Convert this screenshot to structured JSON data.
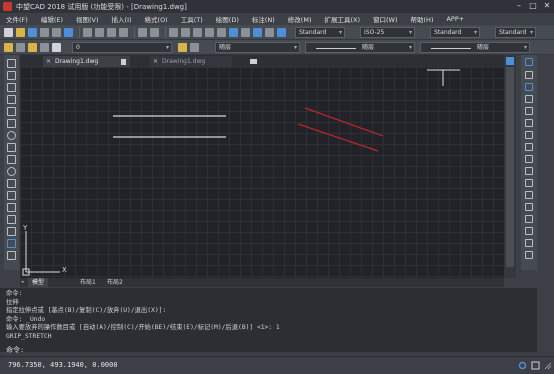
{
  "window": {
    "title": "中望CAD 2018 试用版 (功能受限) - [Drawing1.dwg]",
    "controls": [
      "–",
      "□",
      "✕"
    ]
  },
  "menu": [
    "文件(F)",
    "编辑(E)",
    "视图(V)",
    "插入(I)",
    "格式(O)",
    "工具(T)",
    "绘图(D)",
    "标注(N)",
    "修改(M)",
    "扩展工具(X)",
    "窗口(W)",
    "帮助(H)",
    "APP+"
  ],
  "toolbar": {
    "text_style": "Standard",
    "dim_style": "ISO-25",
    "table_style": "Standard",
    "multileader_style": "Standard",
    "layer": "0",
    "color": "随层",
    "linetype": "随层",
    "lineweight": "随层"
  },
  "doc_tabs": [
    {
      "label": "Drawing1.dwg",
      "active": true
    },
    {
      "label": "Drawing1.dwg",
      "active": false
    }
  ],
  "ucs": {
    "x": "X",
    "y": "Y"
  },
  "layout_tabs": [
    "模型",
    "布局1",
    "布局2"
  ],
  "command_history": [
    "命令:",
    "拉伸",
    "指定拉伸点或 [基点(B)/复制(C)/放弃(U)/退出(X)]:",
    "命令: _Undo",
    "输入要放弃的操作数目或 [自动(A)/控制(C)/开始(BE)/结束(E)/标记(M)/后退(B)] <1>: 1",
    "GRIP_STRETCH"
  ],
  "command_prompt": "命令:",
  "status": {
    "coordinates": "796.7350, 493.1940, 0.0000"
  },
  "colors": {
    "canvas_bg": "#212328",
    "grid": "#2d3035",
    "white_lines": "#d8d8d8",
    "red_lines": "#c0252b",
    "panel_bg": "#3c3f45"
  }
}
